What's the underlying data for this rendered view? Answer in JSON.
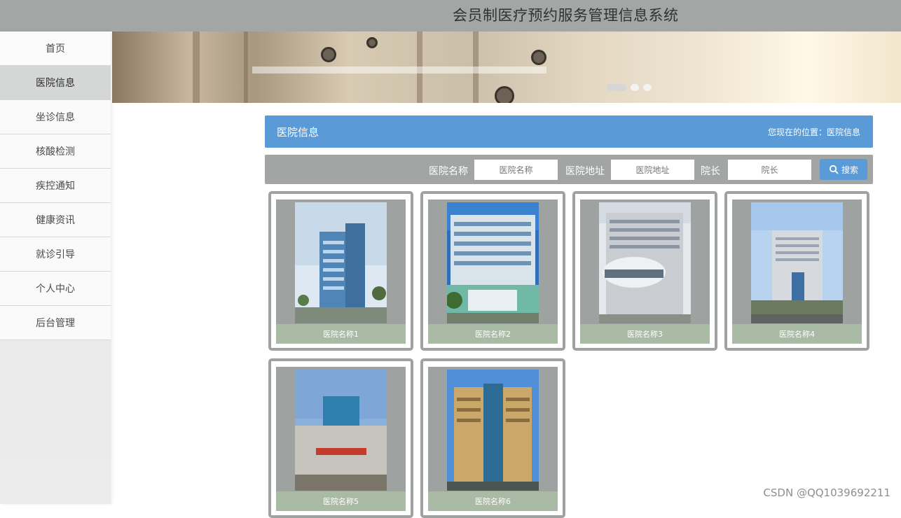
{
  "app": {
    "title": "会员制医疗预约服务管理信息系统"
  },
  "sidebar": {
    "items": [
      {
        "label": "首页"
      },
      {
        "label": "医院信息"
      },
      {
        "label": "坐诊信息"
      },
      {
        "label": "核酸检测"
      },
      {
        "label": "疾控通知"
      },
      {
        "label": "健康资讯"
      },
      {
        "label": "就诊引导"
      },
      {
        "label": "个人中心"
      },
      {
        "label": "后台管理"
      }
    ],
    "active_index": 1
  },
  "section": {
    "title": "医院信息",
    "breadcrumb": "您现在的位置：医院信息"
  },
  "search": {
    "name_label": "医院名称",
    "name_placeholder": "医院名称",
    "address_label": "医院地址",
    "address_placeholder": "医院地址",
    "director_label": "院长",
    "director_placeholder": "院长",
    "button_label": "搜索",
    "button_icon": "search-icon"
  },
  "hospitals": [
    {
      "name": "医院名称1"
    },
    {
      "name": "医院名称2"
    },
    {
      "name": "医院名称3"
    },
    {
      "name": "医院名称4"
    },
    {
      "name": "医院名称5"
    },
    {
      "name": "医院名称6"
    }
  ],
  "banner": {
    "active_slide": 1,
    "slide_count": 3
  },
  "watermark": "CSDN @QQ1039692211",
  "colors": {
    "accent": "#5a9ad6",
    "topbar": "#a3a6a5",
    "caption": "#a9baa5"
  }
}
